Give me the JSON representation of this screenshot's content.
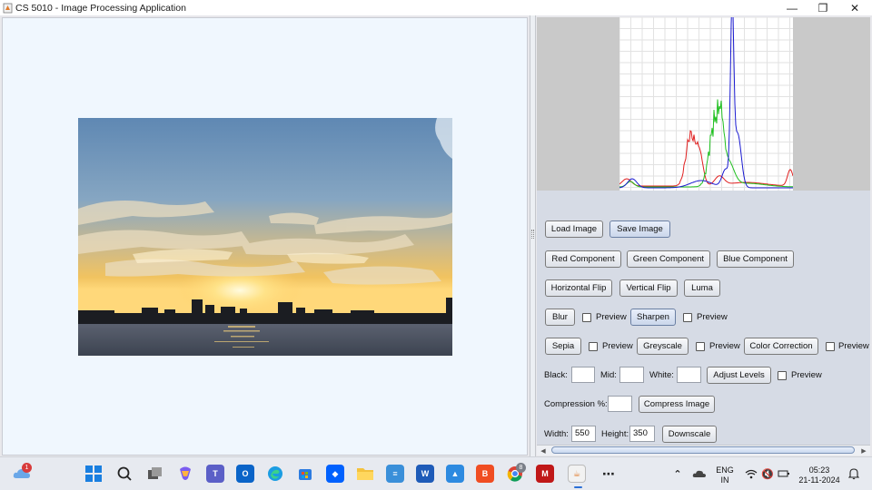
{
  "window": {
    "title": "CS 5010 - Image Processing Application",
    "minimize_glyph": "—",
    "restore_glyph": "❐",
    "close_glyph": "✕"
  },
  "image": {
    "description_icon": "photo-sunset-skyline"
  },
  "histogram": {
    "series_colors": {
      "red": "#e02020",
      "green": "#20c020",
      "blue": "#1a1ad0"
    }
  },
  "controls": {
    "load_image": "Load Image",
    "save_image": "Save Image",
    "red_component": "Red Component",
    "green_component": "Green Component",
    "blue_component": "Blue Component",
    "horizontal_flip": "Horizontal Flip",
    "vertical_flip": "Vertical Flip",
    "luma": "Luma",
    "blur": "Blur",
    "blur_preview": "Preview",
    "sharpen": "Sharpen",
    "sharpen_preview": "Preview",
    "sepia": "Sepia",
    "sepia_preview": "Preview",
    "greyscale": "Greyscale",
    "greyscale_preview": "Preview",
    "color_correction": "Color Correction",
    "color_correction_preview": "Preview",
    "black_label": "Black:",
    "mid_label": "Mid:",
    "white_label": "White:",
    "black_value": "",
    "mid_value": "",
    "white_value": "",
    "adjust_levels": "Adjust Levels",
    "adjust_levels_preview": "Preview",
    "compression_label": "Compression %:",
    "compression_value": "",
    "compress_image": "Compress Image",
    "width_label": "Width:",
    "width_value": "550",
    "height_label": "Height:",
    "height_value": "350",
    "downscale": "Downscale"
  },
  "taskbar": {
    "weather_badge": "1",
    "chrome_badge": "8",
    "language_top": "ENG",
    "language_bottom": "IN",
    "time": "05:23",
    "date": "21-11-2024",
    "icons": [
      "weather-icon",
      "start-icon",
      "search-icon",
      "task-view-icon",
      "copilot-icon",
      "teams-icon",
      "outlook-icon",
      "edge-icon",
      "store-icon",
      "dropbox-icon",
      "file-explorer-icon",
      "notepad-icon",
      "word-icon",
      "photos-icon",
      "brave-icon",
      "chrome-icon",
      "mcafee-icon",
      "java-icon",
      "more-icon"
    ]
  }
}
